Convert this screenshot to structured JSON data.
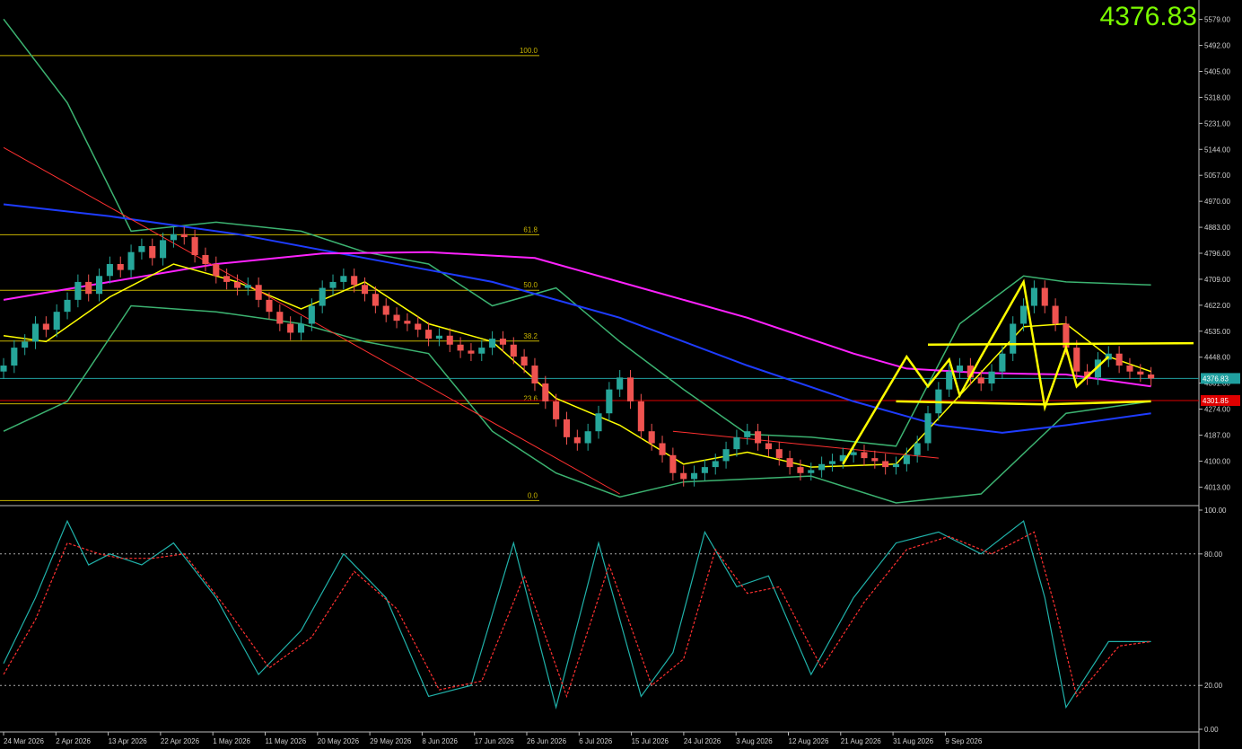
{
  "last_price_label": "4376.83",
  "colors": {
    "background": "#000000",
    "up_candle": "#26a69a",
    "down_candle": "#ef5350",
    "bollinger": "#3cb371",
    "ma_fast": "#ffff00",
    "ma_mid": "#1e3cff",
    "ma_slow": "#ff22ff",
    "fib": "#c8b400",
    "trend": "#ff3030",
    "annotation": "#ffff00",
    "stoch_main": "#20b2aa",
    "stoch_signal": "#ff3030",
    "price_tag_current": "#20a0a0",
    "price_tag_red": "#e00000",
    "big_price": "#7CFC00"
  },
  "chart_data": [
    {
      "type": "candlestick",
      "panel": "price",
      "ylim": [
        3960,
        5620
      ],
      "y_ticks": [
        "5579.00",
        "5492.00",
        "5405.00",
        "5318.00",
        "5231.00",
        "5144.00",
        "5057.00",
        "4970.00",
        "4883.00",
        "4796.00",
        "4709.00",
        "4622.00",
        "4535.00",
        "4448.00",
        "4361.00",
        "4274.00",
        "4187.00",
        "4100.00",
        "4013.00"
      ],
      "x_tick_labels": [
        "24 Mar 2026",
        "2 Apr 2026",
        "13 Apr 2026",
        "22 Apr 2026",
        "1 May 2026",
        "11 May 2026",
        "20 May 2026",
        "29 May 2026",
        "8 Jun 2026",
        "17 Jun 2026",
        "26 Jun 2026",
        "6 Jul 2026",
        "15 Jul 2026",
        "24 Jul 2026",
        "3 Aug 2026",
        "12 Aug 2026",
        "21 Aug 2026",
        "31 Aug 2026",
        "9 Sep 2026"
      ],
      "close_series": [
        4420,
        4480,
        4500,
        4560,
        4540,
        4600,
        4640,
        4700,
        4660,
        4720,
        4760,
        4740,
        4800,
        4820,
        4780,
        4840,
        4860,
        4850,
        4790,
        4760,
        4720,
        4700,
        4680,
        4690,
        4640,
        4600,
        4560,
        4530,
        4560,
        4620,
        4680,
        4700,
        4720,
        4690,
        4660,
        4620,
        4590,
        4570,
        4560,
        4540,
        4510,
        4520,
        4490,
        4470,
        4460,
        4480,
        4510,
        4490,
        4450,
        4420,
        4360,
        4300,
        4240,
        4180,
        4160,
        4200,
        4260,
        4340,
        4380,
        4300,
        4200,
        4160,
        4120,
        4060,
        4040,
        4060,
        4080,
        4100,
        4140,
        4180,
        4200,
        4160,
        4140,
        4110,
        4080,
        4060,
        4070,
        4090,
        4100,
        4120,
        4130,
        4110,
        4100,
        4080,
        4090,
        4120,
        4160,
        4260,
        4340,
        4400,
        4420,
        4380,
        4360,
        4400,
        4460,
        4560,
        4620,
        4680,
        4620,
        4560,
        4480,
        4400,
        4380,
        4440,
        4460,
        4420,
        4400,
        4390,
        4376.83
      ],
      "current_price": 4376.83,
      "current_price_label": "4376.83",
      "red_level": 4302.85,
      "red_level_label": "4301.85",
      "fibonacci": [
        {
          "label": "100.0",
          "value": 5458
        },
        {
          "label": "61.8",
          "value": 4858
        },
        {
          "label": "50.0",
          "value": 4672
        },
        {
          "label": "38.2",
          "value": 4502
        },
        {
          "label": "23.6",
          "value": 4292
        },
        {
          "label": "0.0",
          "value": 3968
        }
      ],
      "moving_averages": [
        {
          "key": "ma_mid",
          "points": [
            [
              0,
              4960
            ],
            [
              10,
              4920
            ],
            [
              22,
              4860
            ],
            [
              34,
              4780
            ],
            [
              46,
              4700
            ],
            [
              58,
              4580
            ],
            [
              70,
              4420
            ],
            [
              80,
              4300
            ],
            [
              88,
              4220
            ],
            [
              94,
              4195
            ],
            [
              100,
              4220
            ],
            [
              108,
              4260
            ]
          ]
        },
        {
          "key": "ma_slow",
          "points": [
            [
              0,
              4640
            ],
            [
              10,
              4700
            ],
            [
              20,
              4760
            ],
            [
              30,
              4795
            ],
            [
              40,
              4800
            ],
            [
              50,
              4780
            ],
            [
              60,
              4680
            ],
            [
              70,
              4580
            ],
            [
              80,
              4460
            ],
            [
              85,
              4410
            ],
            [
              92,
              4395
            ],
            [
              100,
              4390
            ],
            [
              108,
              4350
            ]
          ]
        },
        {
          "key": "ma_fast",
          "points": [
            [
              0,
              4520
            ],
            [
              4,
              4500
            ],
            [
              10,
              4650
            ],
            [
              16,
              4760
            ],
            [
              22,
              4700
            ],
            [
              28,
              4610
            ],
            [
              34,
              4700
            ],
            [
              40,
              4560
            ],
            [
              46,
              4500
            ],
            [
              52,
              4310
            ],
            [
              58,
              4220
            ],
            [
              64,
              4090
            ],
            [
              70,
              4130
            ],
            [
              76,
              4080
            ],
            [
              84,
              4090
            ],
            [
              90,
              4320
            ],
            [
              96,
              4550
            ],
            [
              100,
              4560
            ],
            [
              104,
              4450
            ],
            [
              108,
              4400
            ]
          ]
        }
      ],
      "bollinger": [
        {
          "points": [
            [
              0,
              5580
            ],
            [
              6,
              5300
            ],
            [
              12,
              4870
            ],
            [
              20,
              4900
            ],
            [
              28,
              4870
            ],
            [
              34,
              4800
            ],
            [
              40,
              4760
            ],
            [
              46,
              4620
            ],
            [
              52,
              4680
            ],
            [
              58,
              4500
            ],
            [
              64,
              4340
            ],
            [
              70,
              4190
            ],
            [
              76,
              4180
            ],
            [
              84,
              4150
            ],
            [
              90,
              4560
            ],
            [
              96,
              4720
            ],
            [
              100,
              4700
            ],
            [
              108,
              4690
            ]
          ]
        },
        {
          "points": [
            [
              0,
              4200
            ],
            [
              6,
              4300
            ],
            [
              12,
              4620
            ],
            [
              20,
              4600
            ],
            [
              28,
              4560
            ],
            [
              34,
              4500
            ],
            [
              40,
              4460
            ],
            [
              46,
              4200
            ],
            [
              52,
              4060
            ],
            [
              58,
              3980
            ],
            [
              64,
              4030
            ],
            [
              70,
              4040
            ],
            [
              76,
              4050
            ],
            [
              84,
              3960
            ],
            [
              92,
              3990
            ],
            [
              100,
              4260
            ],
            [
              108,
              4300
            ]
          ]
        }
      ],
      "trend_lines": [
        {
          "points": [
            [
              0,
              5150
            ],
            [
              58,
              3990
            ]
          ]
        },
        {
          "points": [
            [
              63,
              4200
            ],
            [
              88,
              4110
            ]
          ]
        }
      ],
      "annotation_lines": [
        {
          "points": [
            [
              84,
              4300
            ],
            [
              98,
              4290
            ],
            [
              108,
              4300
            ]
          ]
        },
        {
          "points": [
            [
              87,
              4490
            ],
            [
              112,
              4495
            ]
          ]
        },
        {
          "points": [
            [
              79,
              4090
            ],
            [
              85,
              4450
            ],
            [
              87,
              4350
            ],
            [
              89,
              4440
            ],
            [
              90,
              4320
            ],
            [
              92,
              4450
            ],
            [
              96,
              4700
            ],
            [
              98,
              4280
            ],
            [
              100,
              4480
            ],
            [
              101,
              4350
            ],
            [
              104,
              4450
            ]
          ]
        }
      ]
    },
    {
      "type": "line",
      "panel": "stochastic",
      "ylim": [
        0,
        100
      ],
      "y_ticks": [
        "100.00",
        "80.00",
        "20.00",
        "0.00"
      ],
      "levels": [
        80,
        20
      ],
      "series": [
        {
          "key": "stoch_main",
          "points": [
            [
              0,
              30
            ],
            [
              3,
              60
            ],
            [
              6,
              95
            ],
            [
              8,
              75
            ],
            [
              10,
              80
            ],
            [
              13,
              75
            ],
            [
              16,
              85
            ],
            [
              20,
              60
            ],
            [
              24,
              25
            ],
            [
              28,
              45
            ],
            [
              32,
              80
            ],
            [
              36,
              60
            ],
            [
              40,
              15
            ],
            [
              44,
              20
            ],
            [
              48,
              85
            ],
            [
              52,
              10
            ],
            [
              56,
              85
            ],
            [
              60,
              15
            ],
            [
              63,
              35
            ],
            [
              66,
              90
            ],
            [
              69,
              65
            ],
            [
              72,
              70
            ],
            [
              76,
              25
            ],
            [
              80,
              60
            ],
            [
              84,
              85
            ],
            [
              88,
              90
            ],
            [
              92,
              80
            ],
            [
              96,
              95
            ],
            [
              98,
              60
            ],
            [
              100,
              10
            ],
            [
              104,
              40
            ],
            [
              108,
              40
            ]
          ]
        },
        {
          "key": "stoch_signal",
          "points": [
            [
              0,
              25
            ],
            [
              3,
              50
            ],
            [
              6,
              85
            ],
            [
              9,
              80
            ],
            [
              11,
              78
            ],
            [
              14,
              78
            ],
            [
              17,
              80
            ],
            [
              21,
              55
            ],
            [
              25,
              28
            ],
            [
              29,
              42
            ],
            [
              33,
              72
            ],
            [
              37,
              55
            ],
            [
              41,
              18
            ],
            [
              45,
              22
            ],
            [
              49,
              70
            ],
            [
              53,
              15
            ],
            [
              57,
              75
            ],
            [
              61,
              20
            ],
            [
              64,
              32
            ],
            [
              67,
              82
            ],
            [
              70,
              62
            ],
            [
              73,
              65
            ],
            [
              77,
              28
            ],
            [
              81,
              58
            ],
            [
              85,
              82
            ],
            [
              89,
              88
            ],
            [
              93,
              80
            ],
            [
              97,
              90
            ],
            [
              99,
              55
            ],
            [
              101,
              15
            ],
            [
              105,
              38
            ],
            [
              108,
              40
            ]
          ]
        }
      ]
    }
  ]
}
